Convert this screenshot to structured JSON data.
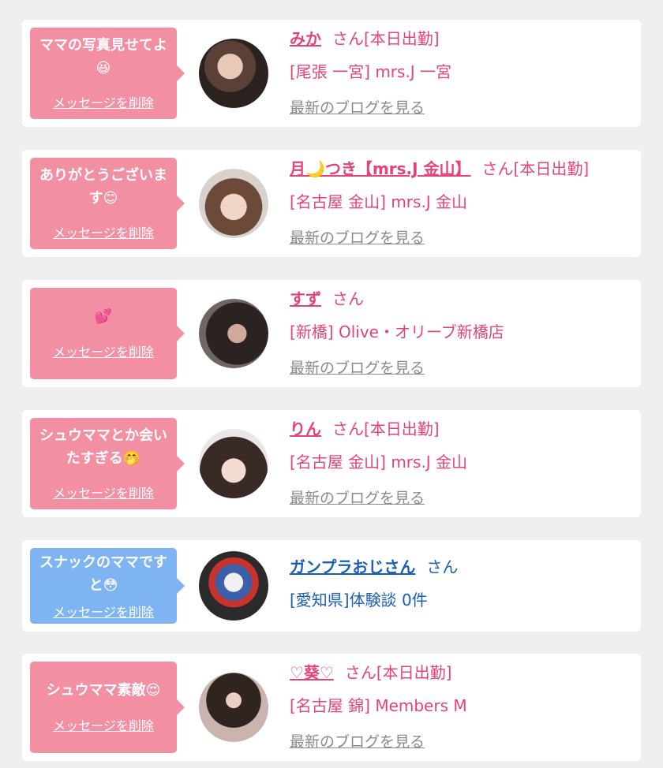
{
  "cards": [
    {
      "message": "ママの写真見せてよ😆",
      "delete_label": "メッセージを削除",
      "name": "みか",
      "suffix": "さん[本日出勤]",
      "shop": "[尾張 一宮] mrs.J 一宮",
      "blog_link": "最新のブログを見る"
    },
    {
      "message": "ありがとうございます😊",
      "delete_label": "メッセージを削除",
      "name": "月🌙つき【mrs.J 金山】",
      "suffix": "さん[本日出勤]",
      "shop": "[名古屋 金山] mrs.J 金山",
      "blog_link": "最新のブログを見る"
    },
    {
      "message": "💕",
      "delete_label": "メッセージを削除",
      "name": "すず",
      "suffix": "さん",
      "shop": "[新橋] Olive・オリーブ新橋店",
      "blog_link": "最新のブログを見る"
    },
    {
      "message": "シュウママとか会いたすぎる🤭",
      "delete_label": "メッセージを削除",
      "name": "りん",
      "suffix": "さん[本日出勤]",
      "shop": "[名古屋 金山] mrs.J 金山",
      "blog_link": "最新のブログを見る"
    },
    {
      "message": "スナックのママですと😳",
      "delete_label": "メッセージを削除",
      "name": "ガンプラおじさん",
      "suffix": "さん",
      "shop": "[愛知県]体験談 0件"
    },
    {
      "message": "シュウママ素敵😍",
      "delete_label": "メッセージを削除",
      "name": "♡葵♡",
      "suffix": "さん[本日出勤]",
      "shop": "[名古屋 錦] Members M",
      "blog_link": "最新のブログを見る"
    }
  ],
  "colors": {
    "pink_bubble": "#f28fa3",
    "blue_bubble": "#7fb4f2",
    "pink_text": "#e4437a",
    "blue_text": "#1a5fb4",
    "gray_link": "#8a8a8a"
  }
}
